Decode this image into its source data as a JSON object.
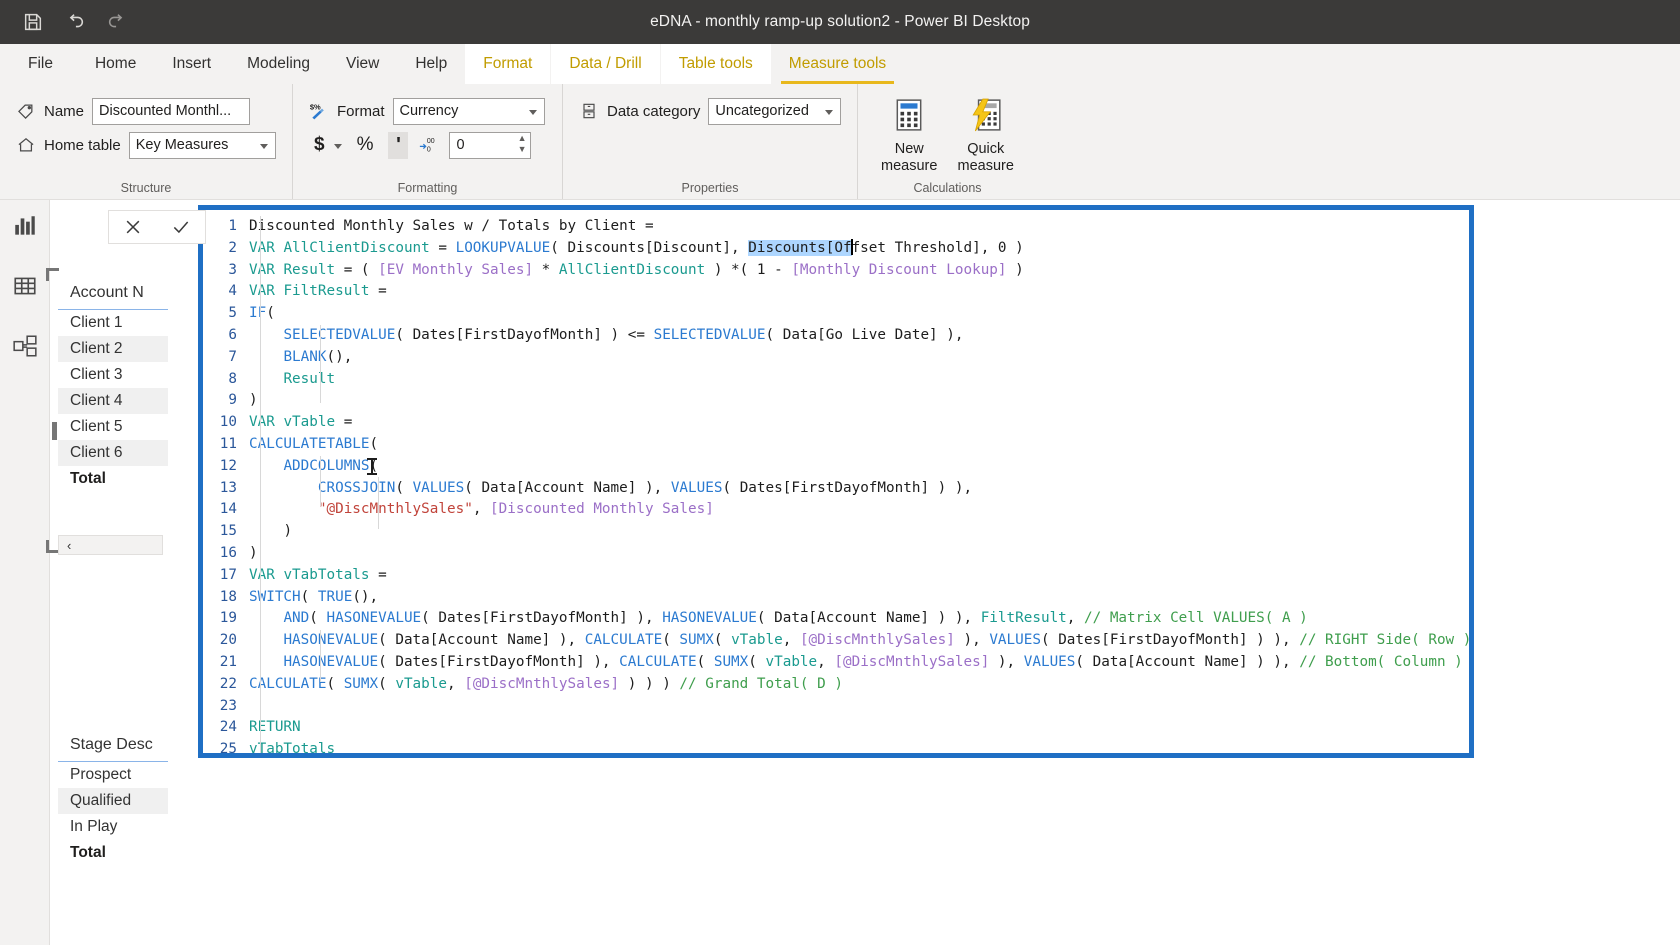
{
  "titlebar": {
    "title": "eDNA - monthly ramp-up solution2 - Power BI Desktop",
    "icons": [
      {
        "name": "save-icon",
        "glyph": "save"
      },
      {
        "name": "undo-icon",
        "glyph": "undo"
      },
      {
        "name": "redo-icon",
        "glyph": "redo"
      }
    ]
  },
  "ribbon_tabs": [
    {
      "id": "file",
      "label": "File"
    },
    {
      "id": "home",
      "label": "Home"
    },
    {
      "id": "insert",
      "label": "Insert"
    },
    {
      "id": "modeling",
      "label": "Modeling"
    },
    {
      "id": "view",
      "label": "View"
    },
    {
      "id": "help",
      "label": "Help"
    },
    {
      "id": "format",
      "label": "Format"
    },
    {
      "id": "data-drill",
      "label": "Data / Drill"
    },
    {
      "id": "table-tools",
      "label": "Table tools"
    },
    {
      "id": "measure-tools",
      "label": "Measure tools"
    }
  ],
  "ribbon": {
    "structure": {
      "group_label": "Structure",
      "name_label": "Name",
      "name_value": "Discounted Monthl...",
      "home_table_label": "Home table",
      "home_table_value": "Key Measures"
    },
    "formatting": {
      "group_label": "Formatting",
      "format_label": "Format",
      "format_value": "Currency",
      "currency_symbol": "$",
      "percent_symbol": "%",
      "comma_symbol": "'",
      "decimal_places_value": "0"
    },
    "properties": {
      "group_label": "Properties",
      "data_category_label": "Data category",
      "data_category_value": "Uncategorized"
    },
    "calculations": {
      "group_label": "Calculations",
      "new_measure_line1": "New",
      "new_measure_line2": "measure",
      "quick_measure_line1": "Quick",
      "quick_measure_line2": "measure"
    }
  },
  "rail": [
    {
      "id": "report",
      "label": "Report view",
      "icon": "bar-chart-icon"
    },
    {
      "id": "data",
      "label": "Data view",
      "icon": "table-icon"
    },
    {
      "id": "model",
      "label": "Model view",
      "icon": "model-icon"
    }
  ],
  "formula_bar": {
    "cancel_label": "✕",
    "commit_label": "✓"
  },
  "visuals": {
    "account_table": {
      "header": "Account N",
      "rows": [
        {
          "label": "Client 1",
          "alt": false,
          "total": false
        },
        {
          "label": "Client 2",
          "alt": true,
          "total": false
        },
        {
          "label": "Client 3",
          "alt": false,
          "total": false
        },
        {
          "label": "Client 4",
          "alt": true,
          "total": false
        },
        {
          "label": "Client 5",
          "alt": false,
          "total": false
        },
        {
          "label": "Client 6",
          "alt": true,
          "total": false
        },
        {
          "label": "Total",
          "alt": false,
          "total": true
        }
      ],
      "collapse_label": "‹"
    },
    "stage_table": {
      "header": "Stage Desc",
      "rows": [
        {
          "label": "Prospect",
          "alt": false,
          "total": false
        },
        {
          "label": "Qualified",
          "alt": true,
          "total": false
        },
        {
          "label": "In Play",
          "alt": false,
          "total": false
        },
        {
          "label": "Total",
          "alt": false,
          "total": true
        }
      ]
    }
  },
  "editor": {
    "border_color": "#1f6fc4",
    "lines": [
      {
        "n": "1",
        "indent": 0,
        "tokens": [
          {
            "c": "t-col",
            "t": "Discounted Monthly Sales w / Totals by Client "
          },
          {
            "c": "t-op",
            "t": "="
          }
        ]
      },
      {
        "n": "2",
        "indent": 0,
        "tokens": [
          {
            "c": "t-kw",
            "t": "VAR"
          },
          {
            "c": "t-op",
            "t": " "
          },
          {
            "c": "t-var",
            "t": "AllClientDiscount"
          },
          {
            "c": "t-op",
            "t": " = "
          },
          {
            "c": "t-fn",
            "t": "LOOKUPVALUE"
          },
          {
            "c": "t-op",
            "t": "( "
          },
          {
            "c": "t-col",
            "t": "Discounts[Discount]"
          },
          {
            "c": "t-op",
            "t": ", "
          },
          {
            "c": "t-col sel",
            "t": "Discounts[Of"
          },
          {
            "c": "caret",
            "t": ""
          },
          {
            "c": "t-col",
            "t": "fset Threshold]"
          },
          {
            "c": "t-op",
            "t": ", "
          },
          {
            "c": "t-num",
            "t": "0"
          },
          {
            "c": "t-op",
            "t": " )"
          }
        ]
      },
      {
        "n": "3",
        "indent": 0,
        "tokens": [
          {
            "c": "t-kw",
            "t": "VAR"
          },
          {
            "c": "t-op",
            "t": " "
          },
          {
            "c": "t-var",
            "t": "Result"
          },
          {
            "c": "t-op",
            "t": " = ( "
          },
          {
            "c": "t-meas",
            "t": "[EV Monthly Sales]"
          },
          {
            "c": "t-op",
            "t": " * "
          },
          {
            "c": "t-var",
            "t": "AllClientDiscount"
          },
          {
            "c": "t-op",
            "t": " ) *( "
          },
          {
            "c": "t-num",
            "t": "1"
          },
          {
            "c": "t-op",
            "t": " - "
          },
          {
            "c": "t-meas",
            "t": "[Monthly Discount Lookup]"
          },
          {
            "c": "t-op",
            "t": " )"
          }
        ]
      },
      {
        "n": "4",
        "indent": 0,
        "tokens": [
          {
            "c": "t-kw",
            "t": "VAR"
          },
          {
            "c": "t-op",
            "t": " "
          },
          {
            "c": "t-var",
            "t": "FiltResult"
          },
          {
            "c": "t-op",
            "t": " ="
          }
        ]
      },
      {
        "n": "5",
        "indent": 0,
        "tokens": [
          {
            "c": "t-fn",
            "t": "IF"
          },
          {
            "c": "t-op",
            "t": "("
          }
        ]
      },
      {
        "n": "6",
        "indent": 1,
        "tokens": [
          {
            "c": "t-fn",
            "t": "SELECTEDVALUE"
          },
          {
            "c": "t-op",
            "t": "( "
          },
          {
            "c": "t-col",
            "t": "Dates[FirstDayofMonth]"
          },
          {
            "c": "t-op",
            "t": " ) <= "
          },
          {
            "c": "t-fn",
            "t": "SELECTEDVALUE"
          },
          {
            "c": "t-op",
            "t": "( "
          },
          {
            "c": "t-col",
            "t": "Data[Go Live Date]"
          },
          {
            "c": "t-op",
            "t": " ),"
          }
        ]
      },
      {
        "n": "7",
        "indent": 1,
        "tokens": [
          {
            "c": "t-fn",
            "t": "BLANK"
          },
          {
            "c": "t-op",
            "t": "(),"
          }
        ]
      },
      {
        "n": "8",
        "indent": 1,
        "tokens": [
          {
            "c": "t-var",
            "t": "Result"
          }
        ]
      },
      {
        "n": "9",
        "indent": 0,
        "tokens": [
          {
            "c": "t-op",
            "t": ")"
          }
        ]
      },
      {
        "n": "10",
        "indent": 0,
        "tokens": [
          {
            "c": "t-kw",
            "t": "VAR"
          },
          {
            "c": "t-op",
            "t": " "
          },
          {
            "c": "t-var",
            "t": "vTable"
          },
          {
            "c": "t-op",
            "t": " ="
          }
        ]
      },
      {
        "n": "11",
        "indent": 0,
        "tokens": [
          {
            "c": "t-fn",
            "t": "CALCULATETABLE"
          },
          {
            "c": "t-op",
            "t": "("
          }
        ]
      },
      {
        "n": "12",
        "indent": 1,
        "tokens": [
          {
            "c": "t-fn",
            "t": "ADDCOLUMNS"
          },
          {
            "c": "t-op",
            "t": "("
          }
        ]
      },
      {
        "n": "13",
        "indent": 2,
        "tokens": [
          {
            "c": "t-fn",
            "t": "CROSSJOIN"
          },
          {
            "c": "t-op",
            "t": "( "
          },
          {
            "c": "t-fn",
            "t": "VALUES"
          },
          {
            "c": "t-op",
            "t": "( "
          },
          {
            "c": "t-col",
            "t": "Data[Account Name]"
          },
          {
            "c": "t-op",
            "t": " ), "
          },
          {
            "c": "t-fn",
            "t": "VALUES"
          },
          {
            "c": "t-op",
            "t": "( "
          },
          {
            "c": "t-col",
            "t": "Dates[FirstDayofMonth]"
          },
          {
            "c": "t-op",
            "t": " ) ),"
          }
        ]
      },
      {
        "n": "14",
        "indent": 2,
        "tokens": [
          {
            "c": "t-str",
            "t": "\"@DiscMnthlySales\""
          },
          {
            "c": "t-op",
            "t": ", "
          },
          {
            "c": "t-meas",
            "t": "[Discounted Monthly Sales]"
          }
        ]
      },
      {
        "n": "15",
        "indent": 1,
        "tokens": [
          {
            "c": "t-op",
            "t": ")"
          }
        ]
      },
      {
        "n": "16",
        "indent": 0,
        "tokens": [
          {
            "c": "t-op",
            "t": ")"
          }
        ]
      },
      {
        "n": "17",
        "indent": 0,
        "tokens": [
          {
            "c": "t-kw",
            "t": "VAR"
          },
          {
            "c": "t-op",
            "t": " "
          },
          {
            "c": "t-var",
            "t": "vTabTotals"
          },
          {
            "c": "t-op",
            "t": " ="
          }
        ]
      },
      {
        "n": "18",
        "indent": 0,
        "tokens": [
          {
            "c": "t-fn",
            "t": "SWITCH"
          },
          {
            "c": "t-op",
            "t": "( "
          },
          {
            "c": "t-fn",
            "t": "TRUE"
          },
          {
            "c": "t-op",
            "t": "(),"
          }
        ]
      },
      {
        "n": "19",
        "indent": 1,
        "tokens": [
          {
            "c": "t-fn",
            "t": "AND"
          },
          {
            "c": "t-op",
            "t": "( "
          },
          {
            "c": "t-fn",
            "t": "HASONEVALUE"
          },
          {
            "c": "t-op",
            "t": "( "
          },
          {
            "c": "t-col",
            "t": "Dates[FirstDayofMonth]"
          },
          {
            "c": "t-op",
            "t": " ), "
          },
          {
            "c": "t-fn",
            "t": "HASONEVALUE"
          },
          {
            "c": "t-op",
            "t": "( "
          },
          {
            "c": "t-col",
            "t": "Data[Account Name]"
          },
          {
            "c": "t-op",
            "t": " ) ), "
          },
          {
            "c": "t-var",
            "t": "FiltResult"
          },
          {
            "c": "t-op",
            "t": ", "
          },
          {
            "c": "t-cmt",
            "t": "// Matrix Cell VALUES( A )"
          }
        ]
      },
      {
        "n": "20",
        "indent": 1,
        "tokens": [
          {
            "c": "t-fn",
            "t": "HASONEVALUE"
          },
          {
            "c": "t-op",
            "t": "( "
          },
          {
            "c": "t-col",
            "t": "Data[Account Name]"
          },
          {
            "c": "t-op",
            "t": " ), "
          },
          {
            "c": "t-fn",
            "t": "CALCULATE"
          },
          {
            "c": "t-op",
            "t": "( "
          },
          {
            "c": "t-fn",
            "t": "SUMX"
          },
          {
            "c": "t-op",
            "t": "( "
          },
          {
            "c": "t-var",
            "t": "vTable"
          },
          {
            "c": "t-op",
            "t": ", "
          },
          {
            "c": "t-meas",
            "t": "[@DiscMnthlySales]"
          },
          {
            "c": "t-op",
            "t": " ), "
          },
          {
            "c": "t-fn",
            "t": "VALUES"
          },
          {
            "c": "t-op",
            "t": "( "
          },
          {
            "c": "t-col",
            "t": "Dates[FirstDayofMonth]"
          },
          {
            "c": "t-op",
            "t": " ) ), "
          },
          {
            "c": "t-cmt",
            "t": "// RIGHT Side( Row ) Totals( B )"
          }
        ]
      },
      {
        "n": "21",
        "indent": 1,
        "tokens": [
          {
            "c": "t-fn",
            "t": "HASONEVALUE"
          },
          {
            "c": "t-op",
            "t": "( "
          },
          {
            "c": "t-col",
            "t": "Dates[FirstDayofMonth]"
          },
          {
            "c": "t-op",
            "t": " ), "
          },
          {
            "c": "t-fn",
            "t": "CALCULATE"
          },
          {
            "c": "t-op",
            "t": "( "
          },
          {
            "c": "t-fn",
            "t": "SUMX"
          },
          {
            "c": "t-op",
            "t": "( "
          },
          {
            "c": "t-var",
            "t": "vTable"
          },
          {
            "c": "t-op",
            "t": ", "
          },
          {
            "c": "t-meas",
            "t": "[@DiscMnthlySales]"
          },
          {
            "c": "t-op",
            "t": " ), "
          },
          {
            "c": "t-fn",
            "t": "VALUES"
          },
          {
            "c": "t-op",
            "t": "( "
          },
          {
            "c": "t-col",
            "t": "Data[Account Name]"
          },
          {
            "c": "t-op",
            "t": " ) ), "
          },
          {
            "c": "t-cmt",
            "t": "// Bottom( Column ) Totals( C )"
          }
        ]
      },
      {
        "n": "22",
        "indent": 0,
        "tokens": [
          {
            "c": "t-fn",
            "t": "CALCULATE"
          },
          {
            "c": "t-op",
            "t": "( "
          },
          {
            "c": "t-fn",
            "t": "SUMX"
          },
          {
            "c": "t-op",
            "t": "( "
          },
          {
            "c": "t-var",
            "t": "vTable"
          },
          {
            "c": "t-op",
            "t": ", "
          },
          {
            "c": "t-meas",
            "t": "[@DiscMnthlySales]"
          },
          {
            "c": "t-op",
            "t": " ) ) ) "
          },
          {
            "c": "t-cmt",
            "t": "// Grand Total( D )"
          }
        ]
      },
      {
        "n": "23",
        "indent": 0,
        "tokens": []
      },
      {
        "n": "24",
        "indent": 0,
        "tokens": [
          {
            "c": "t-kw",
            "t": "RETURN"
          }
        ]
      },
      {
        "n": "25",
        "indent": 0,
        "tokens": [
          {
            "c": "t-var",
            "t": "vTabTotals"
          }
        ]
      }
    ]
  }
}
